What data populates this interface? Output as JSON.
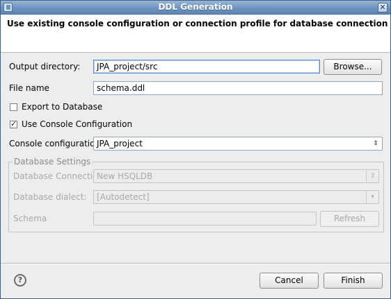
{
  "window": {
    "title": "DDL Generation",
    "close_glyph": "✕"
  },
  "banner": {
    "message": "Use existing console configuration or connection profile for database connection"
  },
  "output_directory": {
    "label": "Output directory:",
    "value": "JPA_project/src",
    "browse_label": "Browse..."
  },
  "file_name": {
    "label": "File name",
    "value": "schema.ddl"
  },
  "export_to_database": {
    "label": "Export to Database",
    "checked": false
  },
  "use_console_configuration": {
    "label": "Use Console Configuration",
    "checked": true
  },
  "console_configuration": {
    "label": "Console configuration:",
    "value": "JPA_project"
  },
  "database_settings": {
    "legend": "Database Settings",
    "connection_label": "Database Connection",
    "connection_value": "New HSQLDB",
    "dialect_label": "Database dialect:",
    "dialect_value": "[Autodetect]",
    "schema_label": "Schema",
    "schema_value": "",
    "refresh_label": "Refresh"
  },
  "footer": {
    "help_glyph": "?",
    "cancel_label": "Cancel",
    "finish_label": "Finish"
  }
}
